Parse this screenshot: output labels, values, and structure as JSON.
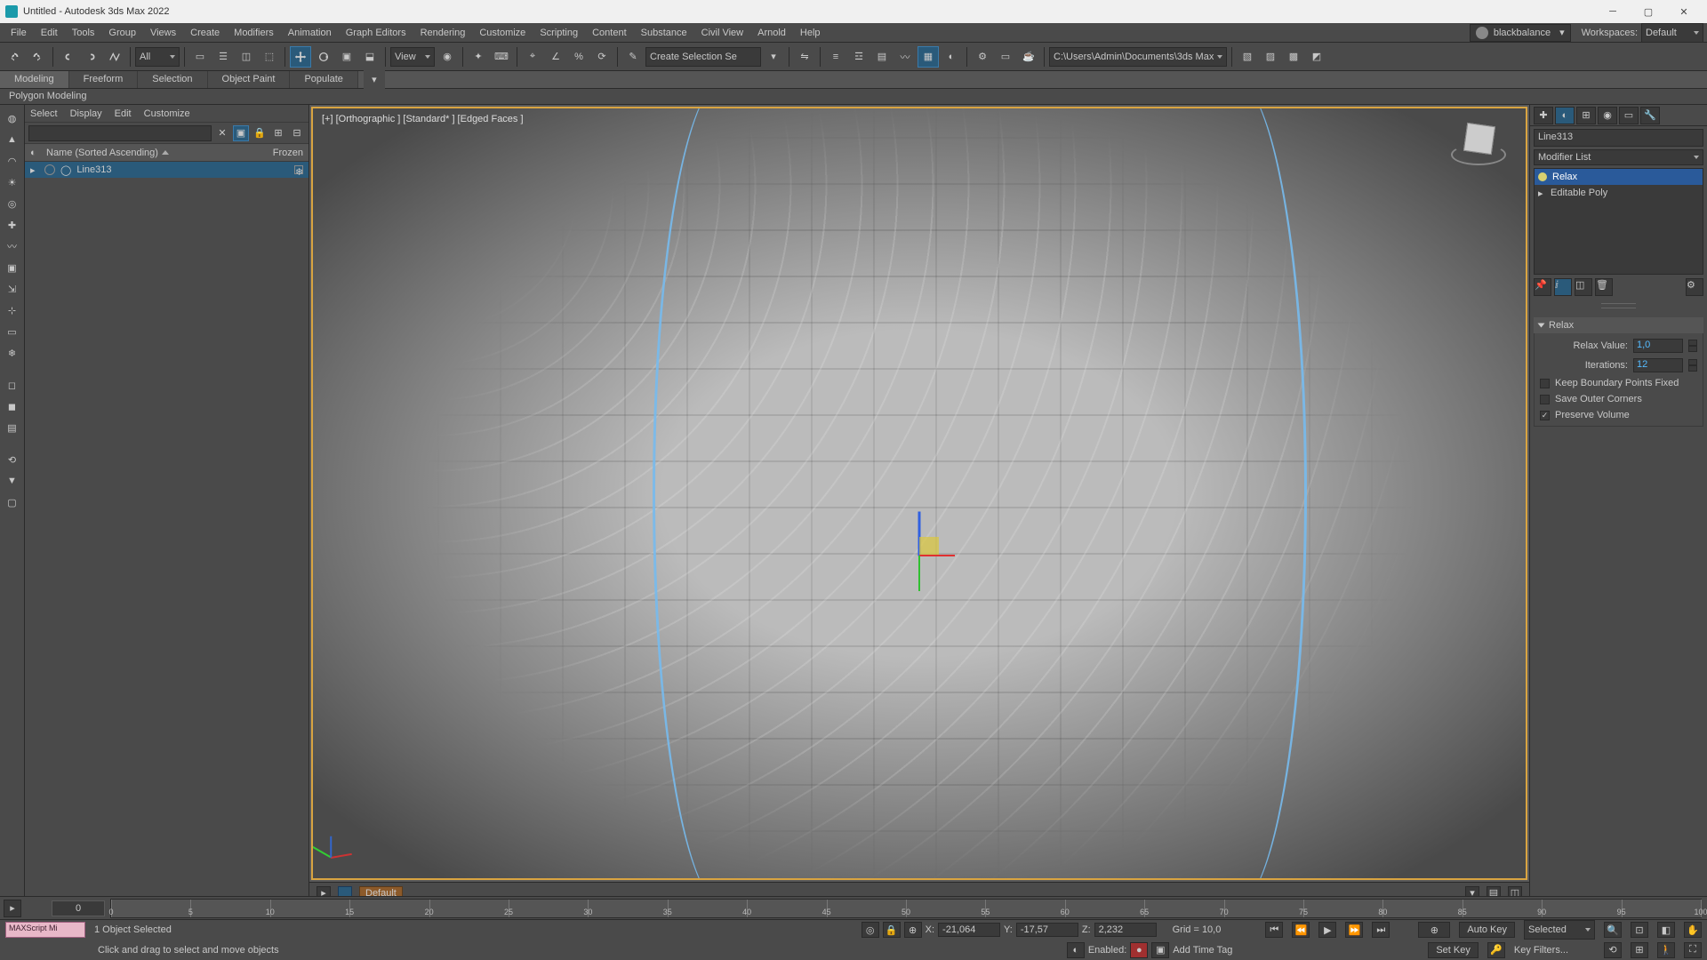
{
  "titlebar": {
    "title": "Untitled - Autodesk 3ds Max 2022"
  },
  "menu": {
    "items": [
      "File",
      "Edit",
      "Tools",
      "Group",
      "Views",
      "Create",
      "Modifiers",
      "Animation",
      "Graph Editors",
      "Rendering",
      "Customize",
      "Scripting",
      "Content",
      "Substance",
      "Civil View",
      "Arnold",
      "Help"
    ],
    "account": "blackbalance",
    "workspaces_label": "Workspaces:",
    "workspace": "Default"
  },
  "maintb": {
    "filter": "All",
    "view": "View",
    "selset": "Create Selection Se",
    "path": "C:\\Users\\Admin\\Documents\\3ds Max 2022"
  },
  "ribbon": {
    "tabs": [
      "Modeling",
      "Freeform",
      "Selection",
      "Object Paint",
      "Populate"
    ],
    "panel": "Polygon Modeling"
  },
  "scenex": {
    "menu": [
      "Select",
      "Display",
      "Edit",
      "Customize"
    ],
    "col_name": "Name (Sorted Ascending)",
    "col_frozen": "Frozen",
    "items": [
      {
        "name": "Line313"
      }
    ]
  },
  "viewport": {
    "label": "[+] [Orthographic ] [Standard* ] [Edged Faces ]",
    "track_default": "Default",
    "frame_display": "0 / 100"
  },
  "timeline": {
    "ticks": [
      0,
      5,
      10,
      15,
      20,
      25,
      30,
      35,
      40,
      45,
      50,
      55,
      60,
      65,
      70,
      75,
      80,
      85,
      90,
      95,
      100
    ]
  },
  "cmd": {
    "object_name": "Line313",
    "modifier_list": "Modifier List",
    "stack": [
      "Relax",
      "Editable Poly"
    ],
    "rollout_title": "Relax",
    "params": {
      "relax_value_label": "Relax Value:",
      "relax_value": "1,0",
      "iterations_label": "Iterations:",
      "iterations": "12",
      "keep_boundary": "Keep Boundary Points Fixed",
      "save_outer": "Save Outer Corners",
      "preserve_volume": "Preserve Volume"
    }
  },
  "status": {
    "maxscript": "MAXScript Mi",
    "selection": "1 Object Selected",
    "prompt": "Click and drag to select and move objects",
    "x_label": "X:",
    "x": "-21,064",
    "y_label": "Y:",
    "y": "-17,57",
    "z_label": "Z:",
    "z": "2,232",
    "grid_label": "Grid = 10,0",
    "enabled": "Enabled:",
    "addtag": "Add Time Tag",
    "autokey": "Auto Key",
    "selected": "Selected",
    "setkey": "Set Key",
    "keyfilters": "Key Filters..."
  }
}
